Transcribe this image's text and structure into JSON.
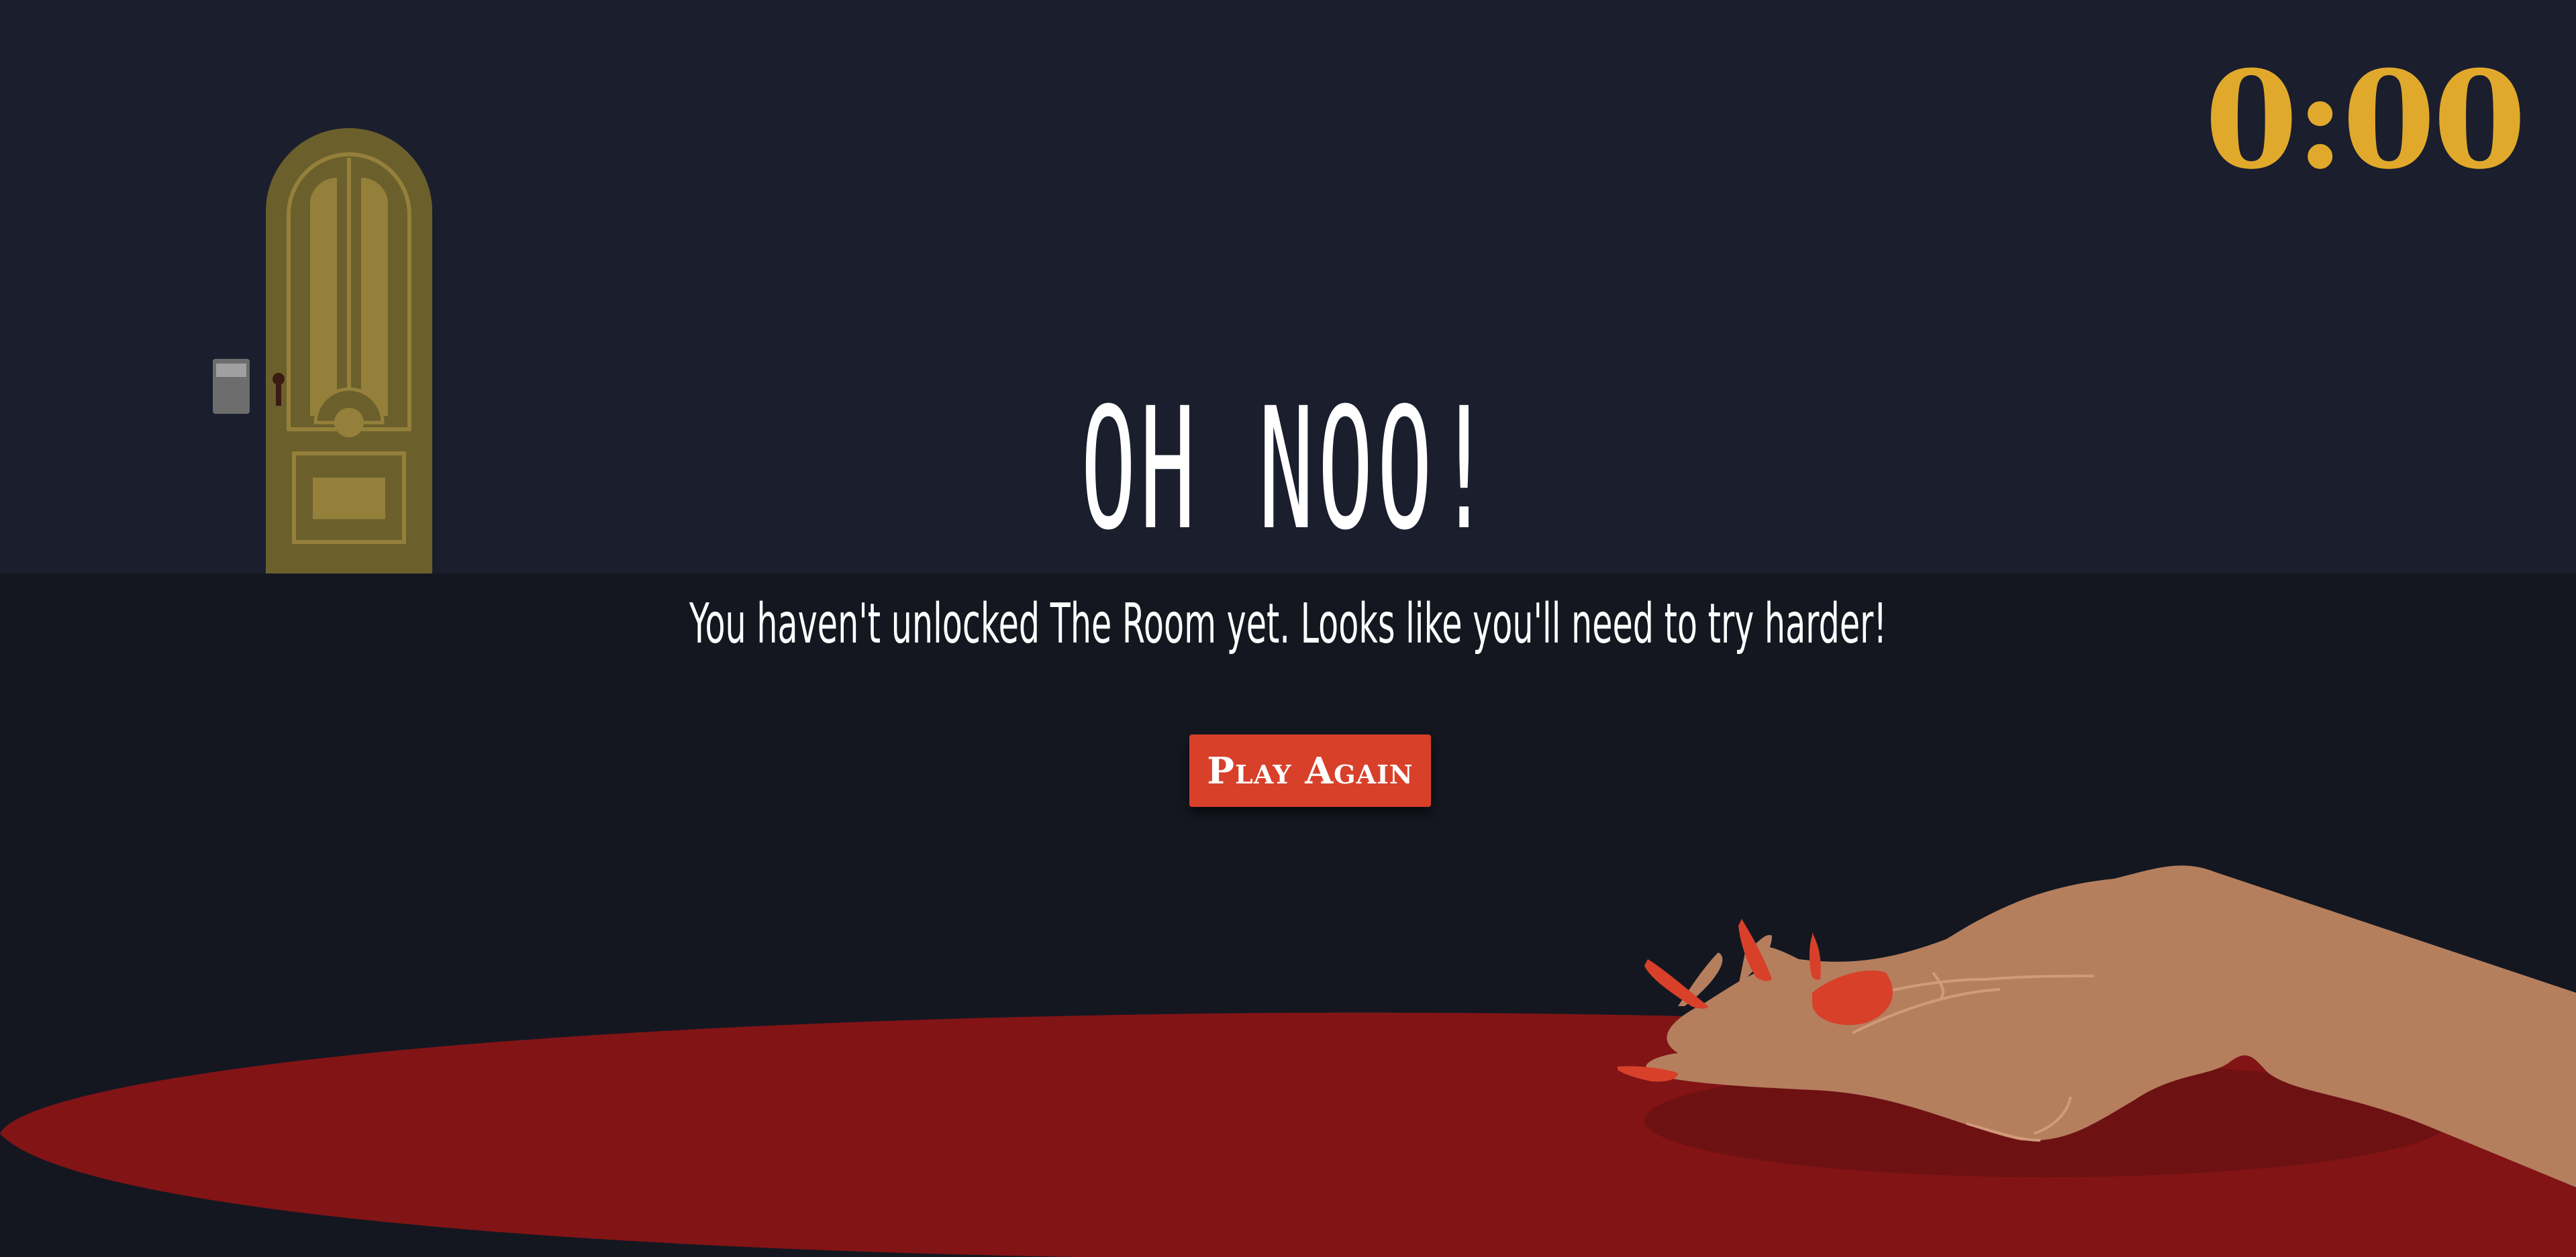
{
  "game": {
    "timer": "0:00",
    "headline": "OH NOO!",
    "message": "You haven't unlocked The Room yet. Looks like you'll need to try harder!",
    "play_again_label": "Play Again"
  },
  "colors": {
    "wall": "#1a1e2d",
    "floor": "#141720",
    "timer": "#e1a92c",
    "button": "#d8402a",
    "blood": "#821416",
    "door": "#6b5f2c",
    "skin": "#b57f5e"
  },
  "icons": {
    "door": "door-icon",
    "keypad": "keypad-icon",
    "hand": "hand-illustration",
    "blood": "blood-pool"
  }
}
